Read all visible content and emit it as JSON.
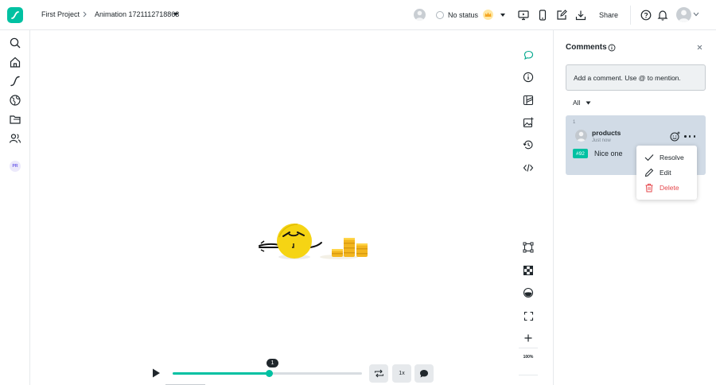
{
  "breadcrumb": {
    "project": "First Project",
    "file": "Animation 1721112718863"
  },
  "status": {
    "label": "No status"
  },
  "toolbar": {
    "share_label": "Share"
  },
  "sidebar": {
    "items": [
      {
        "icon": "search-icon"
      },
      {
        "icon": "home-icon"
      },
      {
        "icon": "pen-icon"
      },
      {
        "icon": "globe-icon"
      },
      {
        "icon": "folder-icon"
      },
      {
        "icon": "users-icon"
      }
    ],
    "workspace_badge": "PR"
  },
  "canvas_tools": {
    "top": [
      "comment-icon",
      "info-icon",
      "layers-icon",
      "image-icon",
      "history-icon",
      "code-icon"
    ],
    "bottom": [
      "bounding-box-icon",
      "checkerboard-icon",
      "color-icon",
      "fullscreen-icon",
      "zoom-in-icon"
    ],
    "zoom_level": "100%"
  },
  "playback": {
    "current_frame": "1",
    "progress": 0.5,
    "speed_label": "1x"
  },
  "comments_panel": {
    "title": "Comments",
    "input_placeholder": "Add a comment. Use @ to mention.",
    "filter_label": "All",
    "comments": [
      {
        "number": "1",
        "user": "products",
        "time": "Just now",
        "tag": "#92",
        "text": "Nice one"
      }
    ]
  },
  "context_menu": {
    "items": [
      {
        "label": "Resolve",
        "icon": "check-icon"
      },
      {
        "label": "Edit",
        "icon": "pencil-icon"
      },
      {
        "label": "Delete",
        "icon": "trash-icon"
      }
    ]
  },
  "colors": {
    "accent": "#00c1a2",
    "danger": "#e5484d",
    "card_bg": "#d1dbe6"
  }
}
